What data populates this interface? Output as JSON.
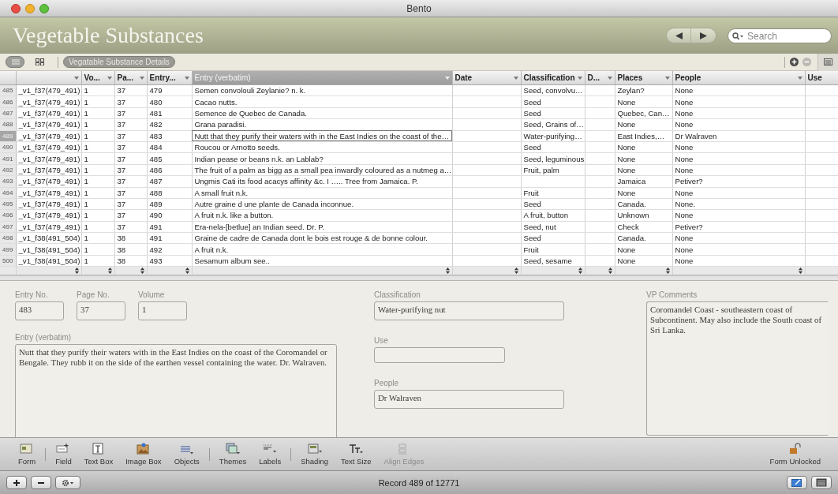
{
  "window": {
    "title": "Bento"
  },
  "header": {
    "title": "Vegetable Substances",
    "search": {
      "placeholder": "Search"
    }
  },
  "view_bar": {
    "views": [
      {
        "kind": "list",
        "selected": true
      },
      {
        "kind": "grid",
        "selected": false
      }
    ],
    "form_tab": {
      "label": "Vegatable Substance Details"
    },
    "remove_disabled": true
  },
  "table": {
    "columns": [
      {
        "selected": false
      },
      {
        "label": "Vo...",
        "selected": false
      },
      {
        "label": "Pa...",
        "selected": false
      },
      {
        "label": "Entry...",
        "selected": false
      },
      {
        "label": "Entry (verbatim)",
        "selected": true
      },
      {
        "label": "Date",
        "selected": false
      },
      {
        "label": "Classification",
        "selected": false
      },
      {
        "label": "D...",
        "selected": false
      },
      {
        "label": "Places",
        "selected": false
      },
      {
        "label": "People",
        "selected": false
      },
      {
        "label": "Use",
        "selected": false
      }
    ],
    "rows": [
      {
        "number": "485",
        "cells": [
          "_v1_f37(479_491)",
          "1",
          "37",
          "479",
          "Semen convolouli Zeylanie? n. k.",
          null,
          "Seed, convolvu…",
          null,
          "Zeylan?",
          "None",
          null
        ],
        "selected": false
      },
      {
        "number": "486",
        "cells": [
          "_v1_f37(479_491)",
          "1",
          "37",
          "480",
          "Cacao nutts.",
          null,
          "Seed",
          null,
          "None",
          "None",
          null
        ],
        "selected": false
      },
      {
        "number": "487",
        "cells": [
          "_v1_f37(479_491)",
          "1",
          "37",
          "481",
          "Semence de Quebec de Canada.",
          null,
          "Seed",
          null,
          "Quebec, Can…",
          "None",
          null
        ],
        "selected": false
      },
      {
        "number": "488",
        "cells": [
          "_v1_f37(479_491)",
          "1",
          "37",
          "482",
          "Grana paradisi.",
          null,
          "Seed, Grains of…",
          null,
          "None",
          "None",
          null
        ],
        "selected": false
      },
      {
        "number": "489",
        "cells": [
          "_v1_f37(479_491)",
          "1",
          "37",
          "483",
          "Nutt that they purify their waters with in the East Indies on the coast of the…",
          null,
          "Water-purifying…",
          null,
          "East Indies,…",
          "Dr Walraven",
          null
        ],
        "selected": true
      },
      {
        "number": "490",
        "cells": [
          "_v1_f37(479_491)",
          "1",
          "37",
          "484",
          "Roucou or Arnotto seeds.",
          null,
          "Seed",
          null,
          "None",
          "None",
          null
        ],
        "selected": false
      },
      {
        "number": "491",
        "cells": [
          "_v1_f37(479_491)",
          "1",
          "37",
          "485",
          "Indian pease or beans n.k. an Lablab?",
          null,
          "Seed, leguminous",
          null,
          "None",
          "None",
          null
        ],
        "selected": false
      },
      {
        "number": "492",
        "cells": [
          "_v1_f37(479_491)",
          "1",
          "37",
          "486",
          "The fruit of a palm as bigg as a small pea inwardly coloured as a nutmeg a…",
          null,
          "Fruit, palm",
          null,
          "None",
          "None",
          null
        ],
        "selected": false
      },
      {
        "number": "493",
        "cells": [
          "_v1_f37(479_491)",
          "1",
          "37",
          "487",
          "Ungmis Cati its food acacys affinity &c. I ….. Tree from Jamaica. P.",
          null,
          null,
          null,
          "Jamaica",
          "Petiver?",
          null
        ],
        "selected": false
      },
      {
        "number": "494",
        "cells": [
          "_v1_f37(479_491)",
          "1",
          "37",
          "488",
          "A small fruit n.k.",
          null,
          "Fruit",
          null,
          "None",
          "None",
          null
        ],
        "selected": false
      },
      {
        "number": "495",
        "cells": [
          "_v1_f37(479_491)",
          "1",
          "37",
          "489",
          "Autre graine d une plante de Canada inconnue.",
          null,
          "Seed",
          null,
          "Canada.",
          "None.",
          null
        ],
        "selected": false
      },
      {
        "number": "496",
        "cells": [
          "_v1_f37(479_491)",
          "1",
          "37",
          "490",
          "A fruit n.k. like a button.",
          null,
          "A fruit, button",
          null,
          "Unknown",
          "None",
          null
        ],
        "selected": false
      },
      {
        "number": "497",
        "cells": [
          "_v1_f37(479_491)",
          "1",
          "37",
          "491",
          "Era-nela-[betlue] an Indian seed. Dr. P.",
          null,
          "Seed, nut",
          null,
          "Check",
          "Petiver?",
          null
        ],
        "selected": false
      },
      {
        "number": "498",
        "cells": [
          "_v1_f38(491_504)",
          "1",
          "38",
          "491",
          "Graine de cadre de Canada dont le bois est rouge & de bonne colour.",
          null,
          "Seed",
          null,
          "Canada.",
          "None",
          null
        ],
        "selected": false
      },
      {
        "number": "499",
        "cells": [
          "_v1_f38(491_504)",
          "1",
          "38",
          "492",
          "A fruit n.k.",
          null,
          "Fruit",
          null,
          "None",
          "None",
          null
        ],
        "selected": false
      },
      {
        "number": "500",
        "cells": [
          "_v1_f38(491_504)",
          "1",
          "38",
          "493",
          "Sesamum album see..",
          null,
          "Seed, sesame",
          null,
          "None",
          "None",
          null
        ],
        "selected": false
      }
    ]
  },
  "form": {
    "columns": [
      [
        {
          "kind": "row",
          "fields": [
            {
              "label": "Entry No.",
              "value": "483",
              "kind": "small"
            },
            {
              "label": "Page No.",
              "value": "37",
              "kind": "small"
            },
            {
              "label": "Volume",
              "value": "1",
              "kind": "small"
            }
          ]
        },
        {
          "kind": "field",
          "field": {
            "label": "Entry (verbatim)",
            "value": "Nutt that they purify their waters with in the East Indies on the coast of the Coromandel or Bengale. They rubb it on the side of the earthen vessel containing the water. Dr. Walraven.",
            "kind": "area"
          }
        }
      ],
      [
        {
          "kind": "field",
          "field": {
            "label": "Classification",
            "value": "Water-purifying nut",
            "kind": "wide"
          }
        },
        {
          "kind": "field",
          "field": {
            "label": "Use",
            "kind": "medium"
          }
        },
        {
          "kind": "field",
          "field": {
            "label": "People",
            "value": "Dr Walraven",
            "kind": "wide"
          }
        }
      ],
      [
        {
          "kind": "field",
          "field": {
            "label": "VP Comments",
            "value": "Coromandel Coast - southeastern coast of Subcontinent. May also include the South coast of Sri Lanka.",
            "kind": "tall"
          }
        }
      ]
    ]
  },
  "layout_toolbar": {
    "items": [
      {
        "label": "Form",
        "kind": "form",
        "disabled": false
      },
      {
        "label": "Field",
        "kind": "field",
        "disabled": false
      },
      {
        "label": "Text Box",
        "kind": "textbox",
        "disabled": false
      },
      {
        "label": "Image Box",
        "kind": "image",
        "disabled": false
      },
      {
        "label": "Objects",
        "kind": "objects",
        "disabled": false
      },
      {
        "label": "Themes",
        "kind": "themes",
        "disabled": false
      },
      {
        "label": "Labels",
        "kind": "labels",
        "disabled": false
      },
      {
        "label": "Shading",
        "kind": "shading",
        "disabled": false
      },
      {
        "label": "Text Size",
        "kind": "textsize",
        "disabled": false
      },
      {
        "label": "Align Edges",
        "kind": "align",
        "disabled": true
      }
    ],
    "lock": {
      "label": "Form Unlocked",
      "locked": false
    }
  },
  "status_bar": {
    "record": "Record 489 of 12771"
  }
}
